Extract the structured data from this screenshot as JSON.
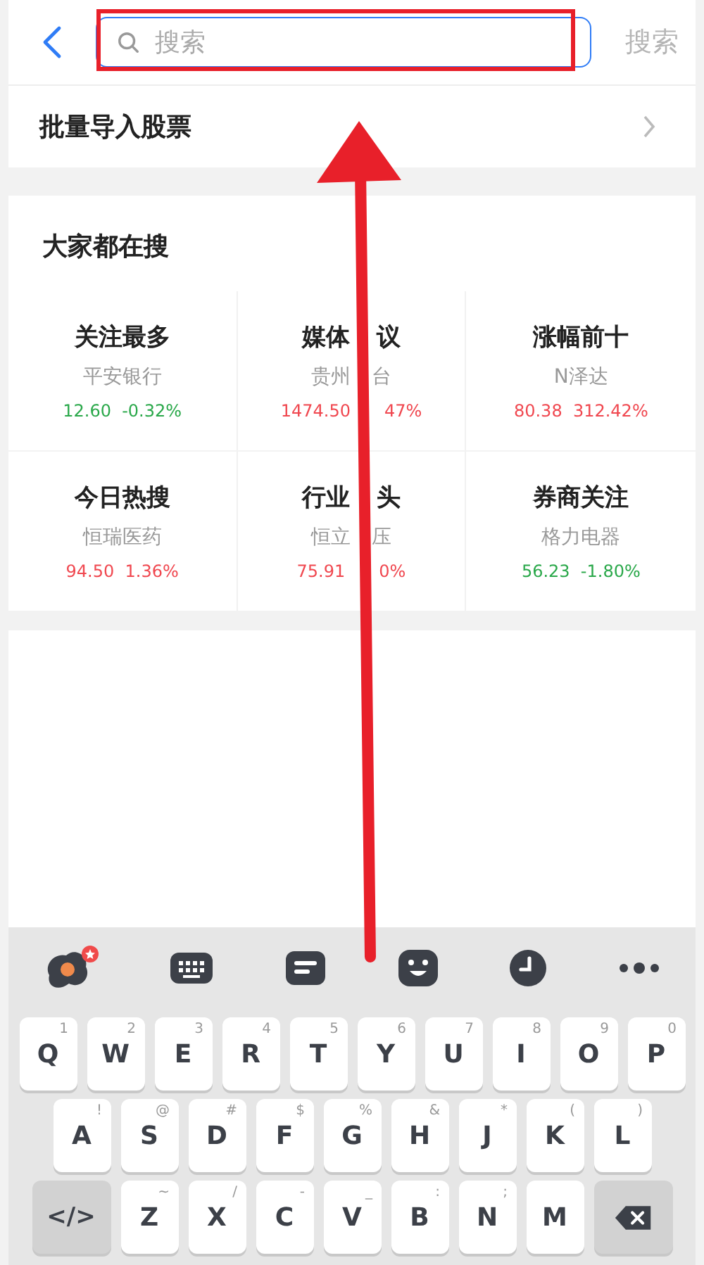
{
  "header": {
    "search": {
      "placeholder": "搜索"
    },
    "search_button": "搜索"
  },
  "import_row": {
    "label": "批量导入股票"
  },
  "hot": {
    "title": "大家都在搜",
    "items": [
      {
        "title": [
          "关注最多"
        ],
        "stock": [
          "平安银行"
        ],
        "quote": [
          "12.60  -0.32%"
        ],
        "color": "#2aa84a"
      },
      {
        "title": [
          "媒体",
          "议"
        ],
        "stock": [
          "贵州",
          "台"
        ],
        "quote": [
          "1474.50",
          "47%"
        ],
        "color": "#f0474f"
      },
      {
        "title": [
          "涨幅前十"
        ],
        "stock": [
          "N泽达"
        ],
        "quote": [
          "80.38  312.42%"
        ],
        "color": "#f0474f"
      },
      {
        "title": [
          "今日热搜"
        ],
        "stock": [
          "恒瑞医药"
        ],
        "quote": [
          "94.50  1.36%"
        ],
        "color": "#f0474f"
      },
      {
        "title": [
          "行业",
          "头"
        ],
        "stock": [
          "恒立",
          "压"
        ],
        "quote": [
          "75.91",
          "0%"
        ],
        "color": "#f0474f"
      },
      {
        "title": [
          "券商关注"
        ],
        "stock": [
          "格力电器"
        ],
        "quote": [
          "56.23  -1.80%"
        ],
        "color": "#2aa84a"
      }
    ]
  },
  "keyboard": {
    "toolbar": [
      {
        "kind": "skin",
        "badge": true
      },
      {
        "kind": "keypad"
      },
      {
        "kind": "clipboard"
      },
      {
        "kind": "emoji"
      },
      {
        "kind": "clock"
      },
      {
        "kind": "more"
      }
    ],
    "rows": [
      [
        {
          "kind": "letter",
          "key": "Q",
          "hint": "1"
        },
        {
          "kind": "letter",
          "key": "W",
          "hint": "2"
        },
        {
          "kind": "letter",
          "key": "E",
          "hint": "3"
        },
        {
          "kind": "letter",
          "key": "R",
          "hint": "4"
        },
        {
          "kind": "letter",
          "key": "T",
          "hint": "5"
        },
        {
          "kind": "letter",
          "key": "Y",
          "hint": "6"
        },
        {
          "kind": "letter",
          "key": "U",
          "hint": "7"
        },
        {
          "kind": "letter",
          "key": "I",
          "hint": "8"
        },
        {
          "kind": "letter",
          "key": "O",
          "hint": "9"
        },
        {
          "kind": "letter",
          "key": "P",
          "hint": "0"
        }
      ],
      [
        {
          "kind": "letter",
          "key": "A",
          "hint": "!"
        },
        {
          "kind": "letter",
          "key": "S",
          "hint": "@"
        },
        {
          "kind": "letter",
          "key": "D",
          "hint": "#"
        },
        {
          "kind": "letter",
          "key": "F",
          "hint": "$"
        },
        {
          "kind": "letter",
          "key": "G",
          "hint": "%"
        },
        {
          "kind": "letter",
          "key": "H",
          "hint": "&"
        },
        {
          "kind": "letter",
          "key": "J",
          "hint": "*"
        },
        {
          "kind": "letter",
          "key": "K",
          "hint": "("
        },
        {
          "kind": "letter",
          "key": "L",
          "hint": ")"
        }
      ],
      [
        {
          "kind": "code",
          "key": "</>"
        },
        {
          "kind": "letter",
          "key": "Z",
          "hint": "~"
        },
        {
          "kind": "letter",
          "key": "X",
          "hint": "/"
        },
        {
          "kind": "letter",
          "key": "C",
          "hint": "-"
        },
        {
          "kind": "letter",
          "key": "V",
          "hint": "_"
        },
        {
          "kind": "letter",
          "key": "B",
          "hint": ":"
        },
        {
          "kind": "letter",
          "key": "N",
          "hint": ";"
        },
        {
          "kind": "letter",
          "key": "M"
        },
        {
          "kind": "backspace"
        }
      ]
    ]
  }
}
